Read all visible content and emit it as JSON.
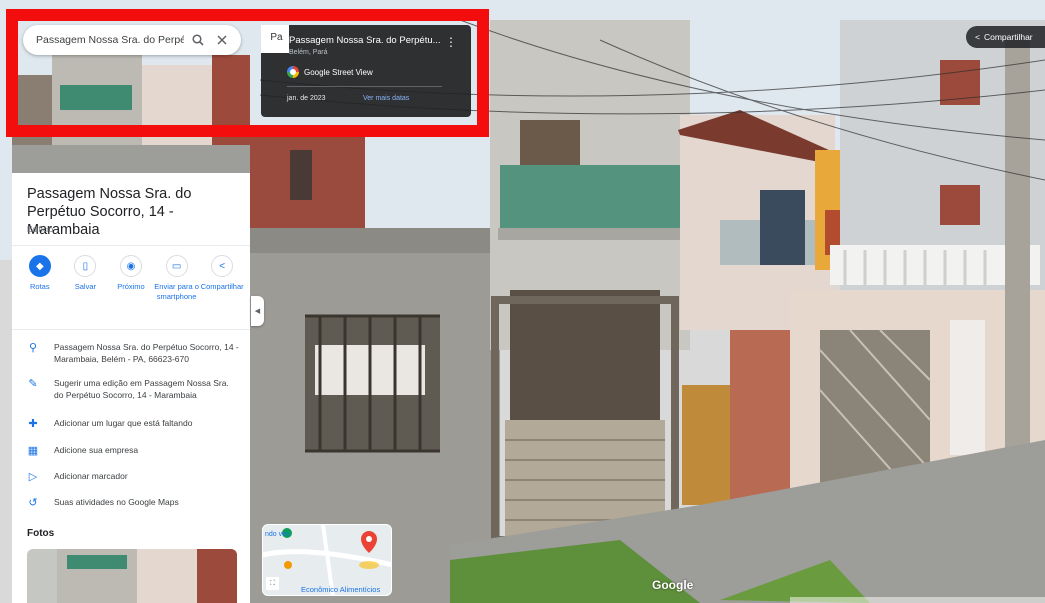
{
  "search": {
    "query": "Passagem Nossa Sra. do Perpétuo S",
    "search_icon": "search-icon",
    "close_icon": "close-icon"
  },
  "streetview_card": {
    "thumb_label": "Pa",
    "title": "Passagem Nossa Sra. do Perpétu...",
    "subtitle": "Belém, Pará",
    "brand": "Google Street View",
    "date": "jan. de 2023",
    "more_dates": "Ver mais datas"
  },
  "place": {
    "title": "Passagem Nossa Sra. do Perpétuo Socorro, 14 - Marambaia",
    "type": "Edifício"
  },
  "actions": [
    {
      "label": "Rotas",
      "icon": "directions-icon"
    },
    {
      "label": "Salvar",
      "icon": "bookmark-icon"
    },
    {
      "label": "Próximo",
      "icon": "nearby-icon"
    },
    {
      "label": "Enviar para o smartphone",
      "icon": "phone-icon"
    },
    {
      "label": "Compartilhar",
      "icon": "share-icon"
    }
  ],
  "info": [
    {
      "text": "Passagem Nossa Sra. do Perpétuo Socorro, 14 - Marambaia, Belém - PA, 66623-670",
      "icon": "location-pin-icon"
    },
    {
      "text": "Sugerir uma edição em Passagem Nossa Sra. do Perpétuo Socorro, 14 - Marambaia",
      "icon": "pencil-icon"
    },
    {
      "text": "Adicionar um lugar que está faltando",
      "icon": "add-place-icon"
    },
    {
      "text": "Adicione sua empresa",
      "icon": "store-icon"
    },
    {
      "text": "Adicionar marcador",
      "icon": "label-icon"
    },
    {
      "text": "Suas atividades no Google Maps",
      "icon": "history-icon"
    }
  ],
  "photos_heading": "Fotos",
  "share_button": "Compartilhar",
  "minimap": {
    "label_top": "ndo ves",
    "label_bottom": "Econômico Alimentícios"
  },
  "watermark": "Google",
  "colors": {
    "accent": "#1a73e8",
    "highlight": "#f40d0d",
    "dark_card": "#202124"
  }
}
